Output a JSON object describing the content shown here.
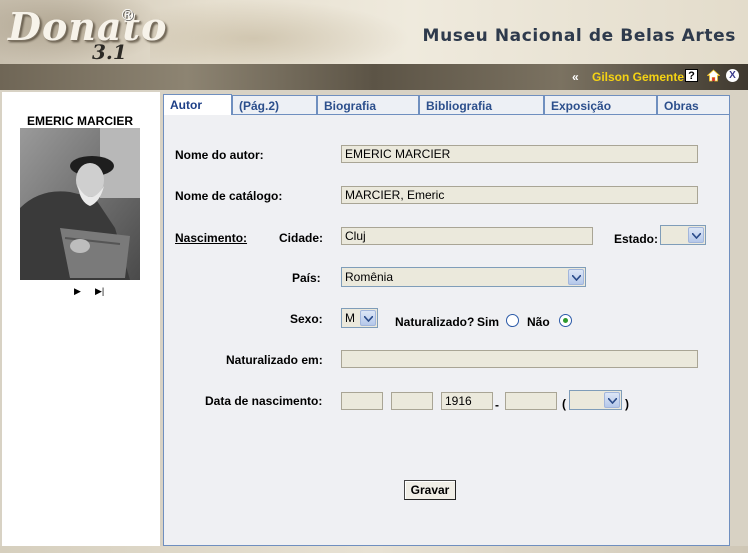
{
  "header": {
    "logo_text": "Donato",
    "logo_reg": "®",
    "logo_version": "3.1",
    "museum_title": "Museu Nacional de Belas Artes"
  },
  "userbar": {
    "back_arrows": "«",
    "user_name": "Gilson Gemente",
    "help_label": "?",
    "exit_label": "X",
    "icons": [
      "help-icon",
      "home-icon",
      "exit-icon"
    ]
  },
  "left": {
    "author_name": "EMERIC MARCIER",
    "nav_next": "▶",
    "nav_last": "▶|"
  },
  "tabs": [
    {
      "label": "Autor",
      "active": true
    },
    {
      "label": "(Pág.2)",
      "active": false
    },
    {
      "label": "Biografia",
      "active": false
    },
    {
      "label": "Bibliografia",
      "active": false
    },
    {
      "label": "Exposição",
      "active": false
    },
    {
      "label": "Obras",
      "active": false
    }
  ],
  "form": {
    "nome_autor_label": "Nome do autor:",
    "nome_autor_value": "EMERIC MARCIER",
    "nome_catalogo_label": "Nome de catálogo:",
    "nome_catalogo_value": "MARCIER, Emeric",
    "nascimento_label": "Nascimento:",
    "cidade_label": "Cidade:",
    "cidade_value": "Cluj",
    "estado_label": "Estado:",
    "estado_value": "",
    "pais_label": "País:",
    "pais_value": "Romênia",
    "sexo_label": "Sexo:",
    "sexo_value": "M",
    "naturalizado_label": "Naturalizado?",
    "sim_label": "Sim",
    "nao_label": "Não",
    "naturalizado_selected": "Não",
    "naturalizado_em_label": "Naturalizado em:",
    "naturalizado_em_value": "",
    "data_nascimento_label": "Data de nascimento:",
    "data_day": "",
    "data_month": "",
    "data_year": "1916",
    "dash": "-",
    "data_year_end": "",
    "paren_open": "(",
    "paren_close": ")",
    "data_qualifier": "",
    "save_label": "Gravar"
  },
  "colors": {
    "tab_border": "#6f8fbf",
    "tab_text": "#2c4f8c",
    "user_name": "#f5d313",
    "field_bg": "#ebe9dc",
    "panel_bg": "#eff0f3"
  }
}
